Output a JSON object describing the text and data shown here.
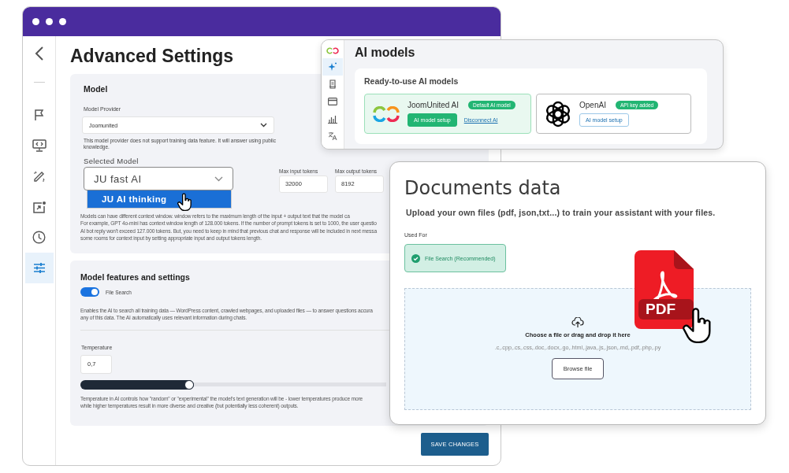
{
  "settings_window": {
    "title": "Advanced Settings",
    "sidebar": {
      "items": [
        {
          "kind": "flag",
          "selected": false
        },
        {
          "kind": "monitor",
          "selected": false
        },
        {
          "kind": "wand",
          "selected": false
        },
        {
          "kind": "image",
          "selected": false
        },
        {
          "kind": "clock",
          "selected": false
        },
        {
          "kind": "sliders",
          "selected": true
        }
      ]
    },
    "model_section": {
      "heading": "Model",
      "provider_label": "Model Provider",
      "provider_value": "Joomunited",
      "provider_note": "This model provider does not support training data feature. It will answer using public knowledge.",
      "selected_model_label": "Selected Model",
      "selected_model_value": "JU fast AI",
      "dropdown_options": [
        {
          "label": "JU AI thinking",
          "selected": true
        }
      ],
      "max_input_label": "Max input tokens",
      "max_input_value": "32000",
      "max_output_label": "Max output tokens",
      "max_output_value": "8192",
      "note_lines": [
        "Models can have different context window. window refers to the maximum length of the input + output text that the model ca",
        "For example, GPT 4o-mini has context window length of 128.000 tokens. If the number of prompt tokens is set to 1000, the user questio",
        "AI bot reply won't exceed 127.000 tokens. But, you need to keep in mind that previous chat and response will be included in next messa",
        "some rooms for context input by setting appropriate input and output tokens length."
      ]
    },
    "features_section": {
      "heading": "Model features and settings",
      "file_search": {
        "label": "File Search",
        "on": true
      },
      "note_lines": [
        "Enables the AI to search all training data — WordPress content, crawled webpages, and uploaded files — to answer questions accura",
        "any of this data. The AI automatically uses relevant information during chats."
      ],
      "temperature_label": "Temperature",
      "temperature_value": "0,7",
      "temperature_slider": {
        "level": 0.37
      },
      "temperature_note_lines": [
        "Temperature in AI controls how \"random\" or \"experimental\" the model's text generation will be - lower temperatures produce more",
        "while higher temperatures result in more diverse and creative (but potentially less coherent) outputs."
      ]
    },
    "save_button": "SAVE CHANGES"
  },
  "ai_models_window": {
    "title": "AI models",
    "sidebar": {
      "items": [
        {
          "kind": "sparkle",
          "selected": true
        },
        {
          "kind": "document",
          "selected": false
        },
        {
          "kind": "card",
          "selected": false
        },
        {
          "kind": "chart",
          "selected": false
        },
        {
          "kind": "translate",
          "selected": false
        }
      ]
    },
    "section_title": "Ready-to-use AI models",
    "models": [
      {
        "kind": "rings",
        "name": "JoomUnited AI",
        "badge": "Default AI model",
        "setup_button": "AI model setup",
        "disconnect_link": "Disconnect AI",
        "selected": true
      },
      {
        "kind": "knot",
        "name": "OpenAI",
        "badge": "API key added",
        "setup_button": "AI model setup",
        "selected": false
      }
    ]
  },
  "documents_window": {
    "title": "Documents data",
    "subtitle": "Upload your own files (pdf, json,txt...) to train your assistant with your files.",
    "used_for_label": "Used For",
    "used_for_option": {
      "label": "File Search (Recommended)",
      "checked": true
    },
    "dropzone": {
      "prompt": "Choose a file or drag and drop it here",
      "extensions": ".c,.cpp,.cs,.css,.doc,.docx,.go,.html,.java,.js,.json,.md,.pdf,.php,.py",
      "button": "Browse file"
    },
    "pdf_label": "PDF"
  }
}
